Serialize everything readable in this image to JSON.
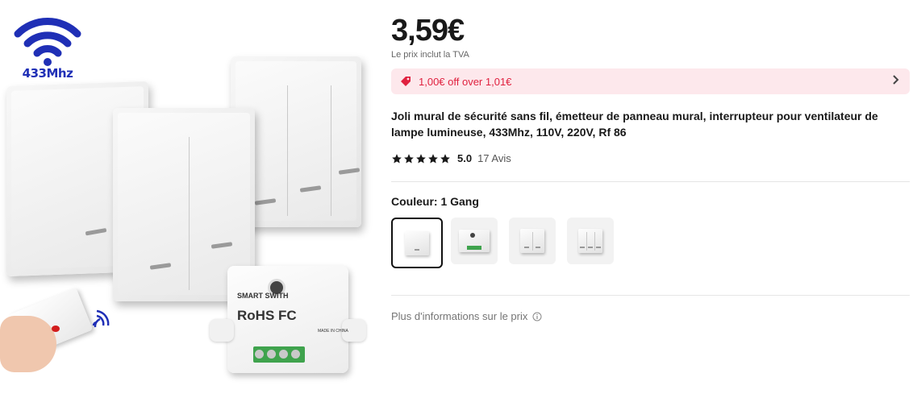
{
  "product_image": {
    "logo_text": "433Mhz",
    "receiver_brand": "SMART SWITH",
    "receiver_marks": "RoHS FC",
    "receiver_made": "MADE IN CHINA",
    "icon": "wifi-signal-icon"
  },
  "price": {
    "amount": "3,59€",
    "vat_note": "Le prix inclut la TVA"
  },
  "coupon": {
    "text": "1,00€ off over 1,01€",
    "icon": "tag-icon",
    "color": "#e0213f",
    "background": "#fde8ec"
  },
  "product": {
    "title": "Joli mural de sécurité sans fil, émetteur de panneau mural, interrupteur pour ventilateur de lampe lumineuse, 433Mhz, 110V, 220V, Rf 86"
  },
  "rating": {
    "value": "5.0",
    "stars": 5,
    "count_text": "17 Avis"
  },
  "color_option": {
    "label": "Couleur: 1 Gang",
    "selected_index": 0,
    "swatches": [
      {
        "name": "1 Gang"
      },
      {
        "name": "Receiver"
      },
      {
        "name": "2 Gang"
      },
      {
        "name": "3 Gang"
      }
    ]
  },
  "more_info": {
    "text": "Plus d'informations sur le prix",
    "icon": "info-circle-icon"
  }
}
